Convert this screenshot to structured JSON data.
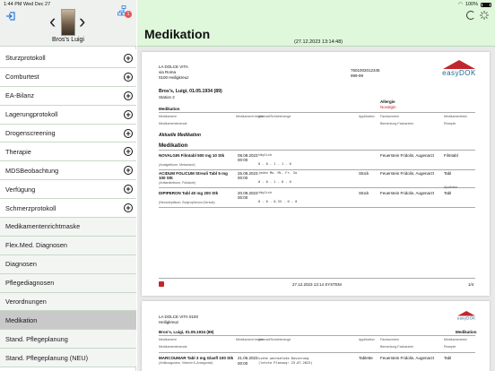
{
  "status_bar": {
    "time": "1:44 PM",
    "date": "Wed Dec 27",
    "battery": "100%"
  },
  "sidebar": {
    "patient_name": "Bros's Luigi",
    "notification_count": "1",
    "items": [
      {
        "label": "Sturzprotokoll",
        "expandable": true
      },
      {
        "label": "Comburtest",
        "expandable": true
      },
      {
        "label": "EA-Bilanz",
        "expandable": true
      },
      {
        "label": "Lagerungprotokoll",
        "expandable": true
      },
      {
        "label": "Drogenscreening",
        "expandable": true
      },
      {
        "label": "Therapie",
        "expandable": true
      },
      {
        "label": "MDSBeobachtung",
        "expandable": true
      },
      {
        "label": "Verfügung",
        "expandable": true
      },
      {
        "label": "Schmerzprotokoll",
        "expandable": true
      },
      {
        "label": "Medikamentenrichtmaske",
        "expandable": false
      },
      {
        "label": "Flex.Med. Diagnosen",
        "expandable": false
      },
      {
        "label": "Diagnosen",
        "expandable": false
      },
      {
        "label": "Pflegediagnosen",
        "expandable": false
      },
      {
        "label": "Verordnungen",
        "expandable": false
      },
      {
        "label": "Medikation",
        "expandable": false,
        "active": true
      },
      {
        "label": "Stand. Pflegeplanung",
        "expandable": false
      },
      {
        "label": "Stand. Pflegeplanung (NEU)",
        "expandable": false
      }
    ]
  },
  "main": {
    "title": "Medikation",
    "timestamp": "(27.12.2023 13:14:48)",
    "page1": {
      "org_name": "LA DOLCE VITA",
      "org_street": "via Roma",
      "org_city": "0100 Heiligkreuz",
      "phone": "7601002012345",
      "fax": "999-99",
      "logo_text": "easyDOK",
      "patient_line": "Bros's, Luigi, 01.05.1934 (89)",
      "station": "Station 2",
      "allergy_label": "Allergie",
      "allergy_value": "Novalgin",
      "section_medikation": "Medikation",
      "col_medikament": "Medikament",
      "col_medikament_beg": "Medikament beginn",
      "col_intervall": "Intervall/Schichtmenge",
      "col_applikation": "Applikation",
      "col_facharzt": "Facharzneen",
      "col_medikament_von": "Medikamentrest",
      "col_beendet": "Medikamentenende",
      "col_bemerkung": "Bemerkung Facharzten",
      "col_rezept": "Rezepte",
      "aktuelle": "Aktuelle Medikation",
      "section_medikation2": "Medikation",
      "rows": [
        {
          "name": "NOVALGIN Filmtabl 500 mg 10 Stk",
          "sub": "(Analgetikum, Metamizol)",
          "date": "08.08.2023",
          "time": "00:00",
          "freq": "täglich",
          "dose": "0  -  0  -  1  -  1  -  0",
          "applikation": "",
          "doctor": "Feuerstein Fridolin, Augenarzt",
          "note": "Filmtabl"
        },
        {
          "name": "ACIDUM FOLICUM Streuli Tabl 5 mg 100 Stk",
          "sub": "(Antianämikum, Folsäure)",
          "date": "25.09.2023",
          "time": "00:00",
          "freq": "jeden Mo. Mi. Fr. So",
          "dose": "0  -  0  -  1  -  0  -  0",
          "applikation": "Stück",
          "doctor": "Feuerstein Fridolin, Augenarzt",
          "note": "Tabl"
        },
        {
          "name": "DIPIPERON Tabl 40 mg 200 Stk",
          "sub": "(Neuroleptikum, Butyrophenon-Derivat)",
          "date": "20.09.2023",
          "time": "00:00",
          "freq": "täglich",
          "dose": "0  -  0  -  0.33  -  0  -  0",
          "applikation": "Stück",
          "doctor": "Feuerstein Fridolin, Augenarzt",
          "note": "Tabl"
        }
      ],
      "apotheke": "Apotheke",
      "footer_date": "27.12.2023 13:14  SYSTEM",
      "footer_page": "1/4"
    },
    "page2": {
      "org_name": "LA DOLCE VITA 0100",
      "org_city": "Heiligkreuz",
      "logo_text": "easyDOK",
      "patient_line": "Bros's, Luigi, 01.05.1934 (89)",
      "section": "Medikation",
      "row_name": "MARCOUMAR Tabl 3 mg Glasfl 100 Stk",
      "row_sub": "(Antikoagulans, Vitamin K-Antagonist)",
      "row_date": "21.06.2023",
      "row_time": "00:00",
      "row_freq": "siehe wechselnde Dosierung",
      "row_freq2": "(letzte Planung: 25.07.2023)",
      "row_applikation": "Tablette",
      "row_doctor": "Feuerstein Fridolin, Augenarzt",
      "row_note": "Tabl"
    }
  }
}
